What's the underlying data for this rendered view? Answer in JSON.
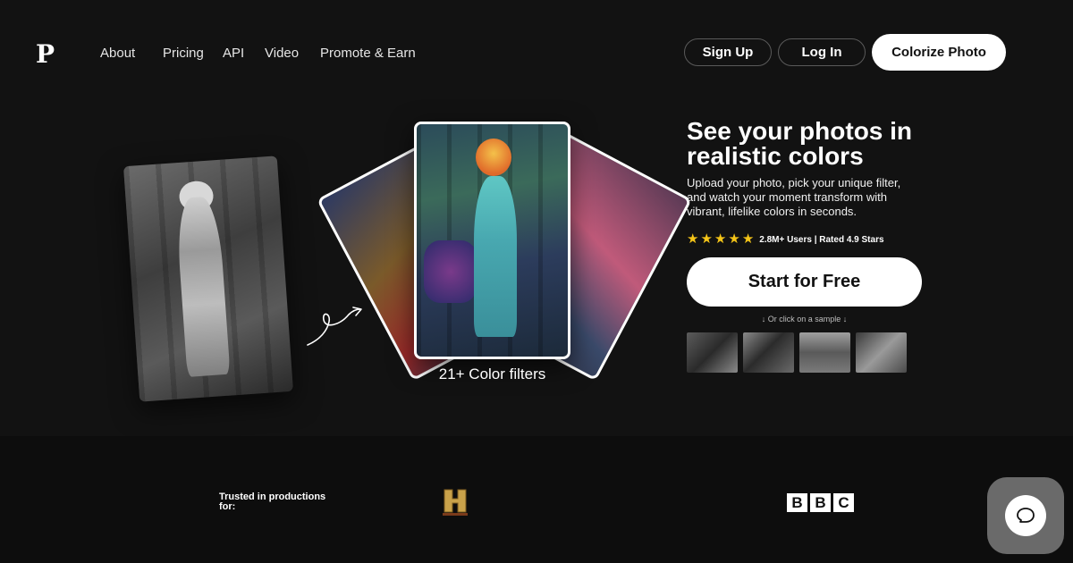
{
  "header": {
    "logo": "P",
    "nav": [
      "About",
      "Pricing",
      "API",
      "Video",
      "Promote & Earn"
    ],
    "sign_up": "Sign Up",
    "log_in": "Log In",
    "colorize": "Colorize Photo"
  },
  "hero": {
    "headline": "See your photos in realistic colors",
    "subtext": "Upload your photo, pick your unique filter, and watch your moment transform with vibrant, lifelike colors in seconds.",
    "stars": 5,
    "rating_text": "2.8M+ Users | Rated 4.9 Stars",
    "start_button": "Start for Free",
    "sample_hint": "↓ Or click on a sample ↓",
    "filters_label": "21+ Color filters"
  },
  "trusted": {
    "label": "Trusted in productions for:",
    "logos": [
      "history-logo",
      "bbc-logo"
    ],
    "bbc_letters": [
      "B",
      "B",
      "C"
    ]
  },
  "colors": {
    "background": "#121212",
    "star": "#f5c518",
    "history_gold": "#c9a24a"
  }
}
